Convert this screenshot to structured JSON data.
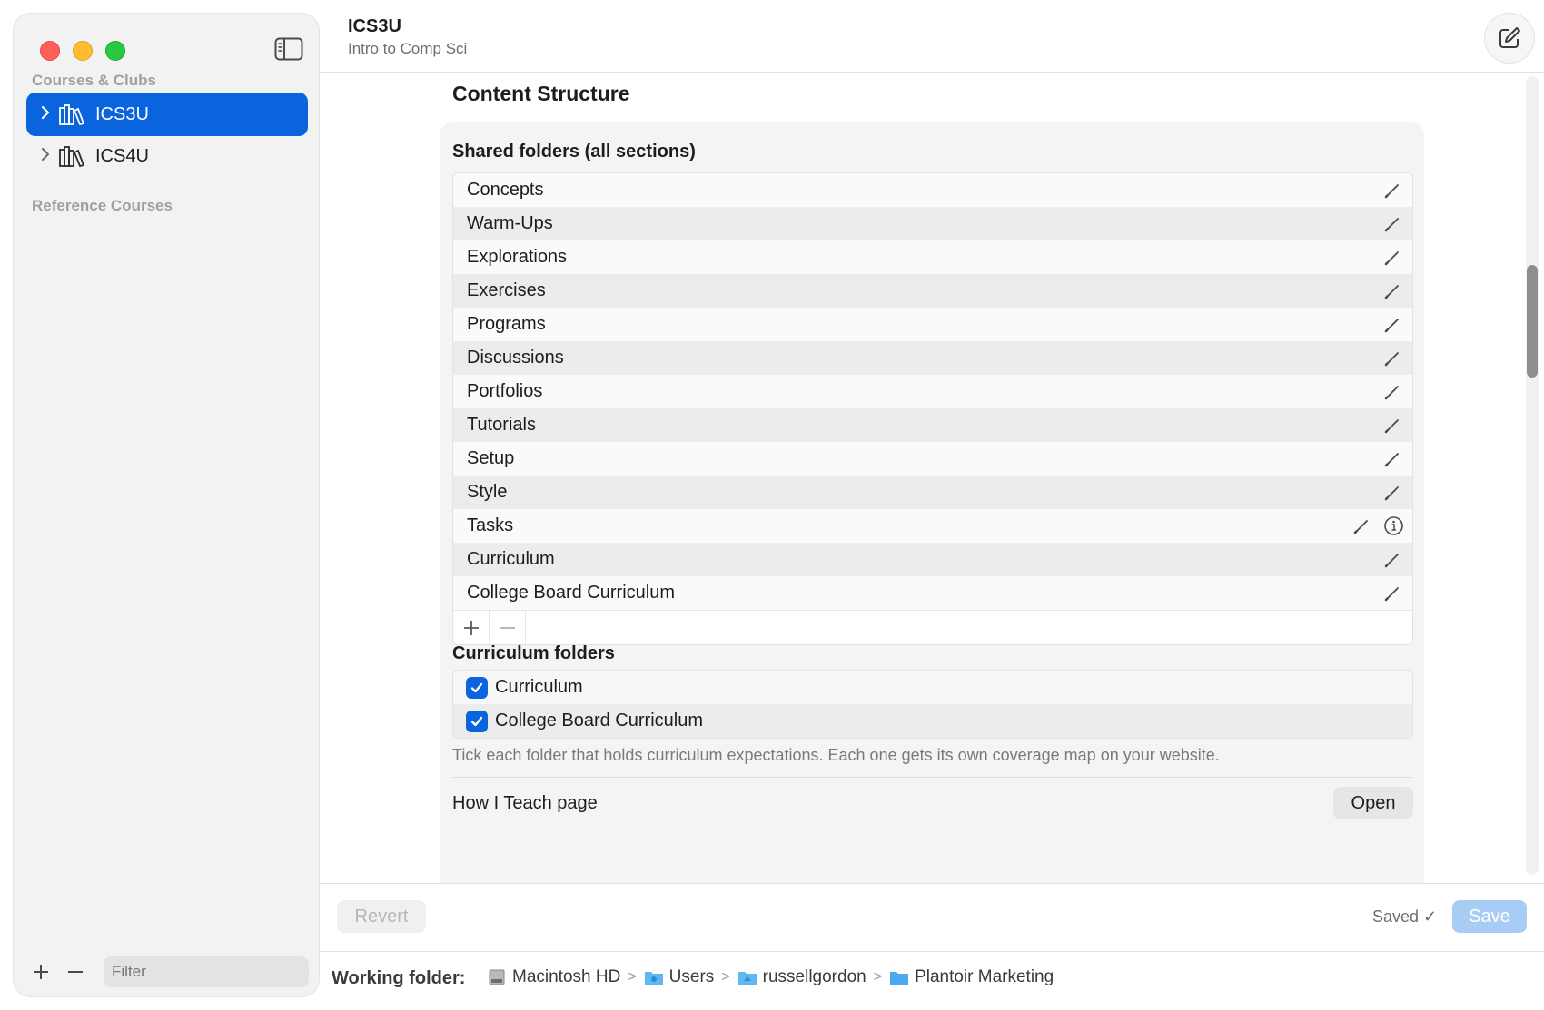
{
  "sidebar": {
    "section_courses": "Courses & Clubs",
    "section_reference": "Reference Courses",
    "items": [
      {
        "label": "ICS3U",
        "selected": true
      },
      {
        "label": "ICS4U",
        "selected": false
      }
    ],
    "filter_placeholder": "Filter"
  },
  "header": {
    "title": "ICS3U",
    "subtitle": "Intro to Comp Sci"
  },
  "content": {
    "section_title": "Content Structure",
    "shared_label": "Shared folders (all sections)",
    "shared_folders": [
      "Concepts",
      "Warm-Ups",
      "Explorations",
      "Exercises",
      "Programs",
      "Discussions",
      "Portfolios",
      "Tutorials",
      "Setup",
      "Style",
      "Tasks",
      "Curriculum",
      "College Board Curriculum"
    ],
    "curriculum_label": "Curriculum folders",
    "curriculum_folders": [
      {
        "label": "Curriculum",
        "checked": true
      },
      {
        "label": "College Board Curriculum",
        "checked": true
      }
    ],
    "hint": "Tick each folder that holds curriculum expectations. Each one gets its own coverage map on your website.",
    "how_label": "How I Teach page",
    "open_label": "Open"
  },
  "footer": {
    "revert_label": "Revert",
    "saved_label": "Saved ✓",
    "save_label": "Save",
    "working_folder_label": "Working folder:",
    "path": [
      "Macintosh HD",
      "Users",
      "russellgordon",
      "Plantoir Marketing"
    ]
  },
  "colors": {
    "accent": "#0a64dd",
    "save_disabled": "#a8cdf5"
  }
}
